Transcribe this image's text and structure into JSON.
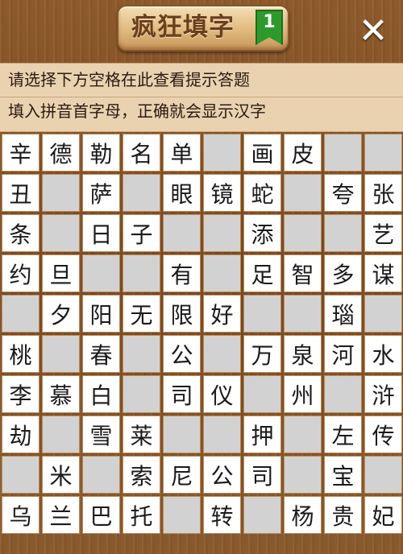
{
  "header": {
    "title": "疯狂填字",
    "level": "1",
    "close_label": "✕"
  },
  "hint": {
    "line1": "请选择下方空格在此查看提示答题",
    "line2": "填入拼音首字母，正确就会显示汉字"
  },
  "grid": [
    [
      "辛",
      "德",
      "勒",
      "名",
      "单",
      "",
      "画",
      "皮",
      "",
      ""
    ],
    [
      "丑",
      "",
      "萨",
      "",
      "眼",
      "镜",
      "蛇",
      "",
      "夸",
      "张"
    ],
    [
      "条",
      "",
      "日",
      "子",
      "",
      "",
      "添",
      "",
      "",
      "艺"
    ],
    [
      "约",
      "旦",
      "",
      "",
      "有",
      "",
      "足",
      "智",
      "多",
      "谋"
    ],
    [
      "",
      "夕",
      "阳",
      "无",
      "限",
      "好",
      "",
      "",
      "瑙",
      ""
    ],
    [
      "桃",
      "",
      "春",
      "",
      "公",
      "",
      "万",
      "泉",
      "河",
      "水"
    ],
    [
      "李",
      "慕",
      "白",
      "",
      "司",
      "仪",
      "",
      "州",
      "",
      "浒"
    ],
    [
      "劫",
      "",
      "雪",
      "莱",
      "",
      "",
      "押",
      "",
      "左",
      "传"
    ],
    [
      "",
      "米",
      "",
      "索",
      "尼",
      "公",
      "司",
      "",
      "宝",
      ""
    ],
    [
      "乌",
      "兰",
      "巴",
      "托",
      "",
      "转",
      "",
      "杨",
      "贵",
      "妃"
    ]
  ]
}
